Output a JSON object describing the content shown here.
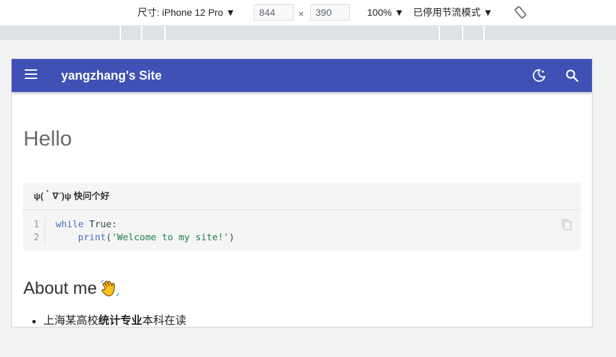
{
  "devtools": {
    "device_label": "尺寸: iPhone 12 Pro ▼",
    "width_value": "844",
    "times": "×",
    "height_value": "390",
    "zoom_label": "100% ▼",
    "throttle_label": "已停用节流模式 ▼",
    "rotate_icon": "rotate-icon"
  },
  "site": {
    "title": "yangzhang's Site",
    "header_color": "#3f51b5"
  },
  "page": {
    "title": "Hello",
    "admonition_title": "ψ(｀∇´)ψ 快问个好",
    "code": {
      "line_numbers": [
        "1",
        "2"
      ],
      "line1_kw": "while",
      "line1_rest": " True:",
      "line2_indent": "    ",
      "line2_fn": "print",
      "line2_open": "(",
      "line2_str": "'Welcome to my site!'",
      "line2_close": ")"
    },
    "about_heading": "About me",
    "bullet1_pre": "上海某高校",
    "bullet1_bold": "统计专业",
    "bullet1_post": "本科在读"
  }
}
